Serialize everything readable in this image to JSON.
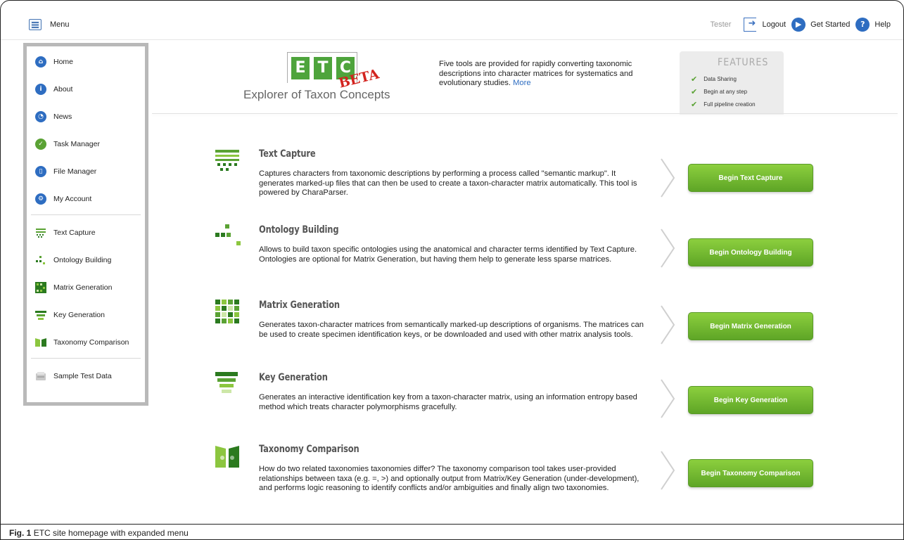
{
  "topbar": {
    "menu_label": "Menu",
    "user": "Tester",
    "logout_label": "Logout",
    "get_started_label": "Get Started",
    "help_label": "Help"
  },
  "sidebar": {
    "items": [
      {
        "label": "Home",
        "icon": "home-icon"
      },
      {
        "label": "About",
        "icon": "info-icon"
      },
      {
        "label": "News",
        "icon": "news-icon"
      },
      {
        "label": "Task Manager",
        "icon": "task-manager-icon"
      },
      {
        "label": "File Manager",
        "icon": "file-manager-icon"
      },
      {
        "label": "My Account",
        "icon": "account-icon"
      }
    ],
    "tools": [
      {
        "label": "Text Capture",
        "icon": "text-capture-icon"
      },
      {
        "label": "Ontology Building",
        "icon": "ontology-building-icon"
      },
      {
        "label": "Matrix Generation",
        "icon": "matrix-generation-icon"
      },
      {
        "label": "Key Generation",
        "icon": "key-generation-icon"
      },
      {
        "label": "Taxonomy Comparison",
        "icon": "taxonomy-comparison-icon"
      }
    ],
    "extra": [
      {
        "label": "Sample Test Data",
        "icon": "sample-data-icon"
      }
    ]
  },
  "header": {
    "logo_letters": [
      "E",
      "T",
      "C"
    ],
    "beta": "BETA",
    "logo_subtitle": "Explorer of Taxon Concepts",
    "intro_text": "Five tools are provided for rapidly converting taxonomic descriptions into character matrices for systematics and evolutionary studies.",
    "more_link": "More",
    "features_title": "FEATURES",
    "features": [
      "Data Sharing",
      "Begin at any step",
      "Full pipeline creation"
    ]
  },
  "tools": [
    {
      "title": "Text Capture",
      "description": "Captures characters from taxonomic descriptions by performing a process called \"semantic markup\". It generates marked-up files that can then be used to create a taxon-character matrix automatically. This tool is powered by CharaParser.",
      "button": "Begin Text Capture"
    },
    {
      "title": "Ontology Building",
      "description": "Allows to build taxon specific ontologies using the anatomical and character terms identified by Text Capture. Ontologies are optional for Matrix Generation, but having them help to generate less sparse matrices.",
      "button": "Begin Ontology Building"
    },
    {
      "title": "Matrix Generation",
      "description": "Generates taxon-character matrices from semantically marked-up descriptions of organisms. The matrices can be used to create specimen identification keys, or be downloaded and used with other matrix analysis tools.",
      "button": "Begin Matrix Generation"
    },
    {
      "title": "Key Generation",
      "description": "Generates an interactive identification key from a taxon-character matrix, using an information entropy based method which treats character polymorphisms gracefully.",
      "button": "Begin Key Generation"
    },
    {
      "title": "Taxonomy Comparison",
      "description": "How do two related taxonomies taxonomies differ? The taxonomy comparison tool takes user-provided relationships between taxa (e.g. =, >) and optionally output from Matrix/Key Generation (under-development), and performs logic reasoning to identify conflicts and/or ambiguities and finally align two taxonomies.",
      "button": "Begin Taxonomy Comparison"
    }
  ],
  "caption": {
    "label": "Fig. 1",
    "text": "ETC site homepage with expanded menu"
  },
  "colors": {
    "accent_green": "#5ea526",
    "link_blue": "#2e6dc1",
    "beta_red": "#d3241f"
  }
}
